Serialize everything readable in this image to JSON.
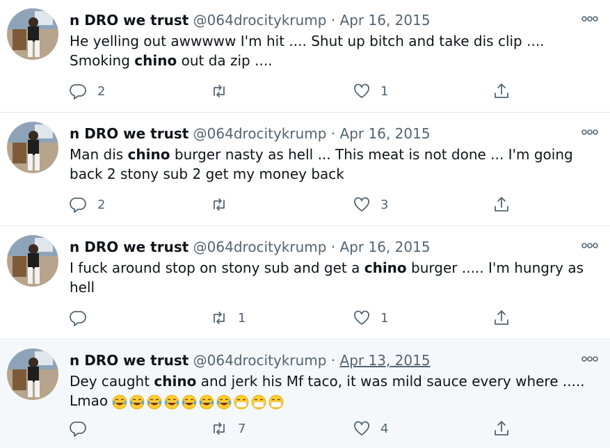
{
  "tweets": [
    {
      "name": "n DRO we trust",
      "handle": "@064drocitykrump",
      "separator": "·",
      "date": "Apr 16, 2015",
      "text_before": "He yelling out awwwww I'm hit .... Shut up bitch and take dis clip .... Smoking ",
      "highlight": "chino",
      "text_after": " out da zip ....",
      "replies": "2",
      "retweets": "",
      "likes": "1"
    },
    {
      "name": "n DRO we trust",
      "handle": "@064drocitykrump",
      "separator": "·",
      "date": "Apr 16, 2015",
      "text_before": "Man dis ",
      "highlight": "chino",
      "text_after": " burger nasty as hell ... This meat is not done ... I'm going back 2 stony sub 2 get my money back",
      "replies": "2",
      "retweets": "",
      "likes": "3"
    },
    {
      "name": "n DRO we trust",
      "handle": "@064drocitykrump",
      "separator": "·",
      "date": "Apr 16, 2015",
      "text_before": "I fuck around stop on stony sub and get a ",
      "highlight": "chino",
      "text_after": " burger ..... I'm hungry as hell",
      "replies": "",
      "retweets": "1",
      "likes": "1"
    },
    {
      "name": "n DRO we trust",
      "handle": "@064drocitykrump",
      "separator": "·",
      "date": "Apr 13, 2015",
      "text_before": "Dey caught ",
      "highlight": "chino",
      "text_after": " and jerk his Mf taco, it was mild sauce every where ..... Lmao ",
      "emojis": [
        "face-with-tears-of-joy",
        "face-with-tears-of-joy",
        "face-with-tears-of-joy",
        "face-with-tears-of-joy",
        "face-with-tears-of-joy",
        "face-with-tears-of-joy",
        "face-with-tears-of-joy",
        "face-with-medical-mask",
        "face-with-medical-mask",
        "face-with-medical-mask"
      ],
      "replies": "",
      "retweets": "7",
      "likes": "4"
    }
  ],
  "colors": {
    "text": "#0f1419",
    "muted": "#536471",
    "divider": "#e6ecf0",
    "hover": "#f5f8fa"
  }
}
